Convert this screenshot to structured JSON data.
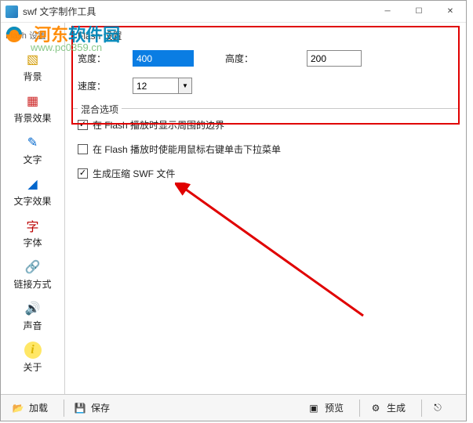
{
  "window": {
    "title": "swf 文字制作工具"
  },
  "watermark": {
    "text_a": "河东",
    "text_b": "软件园",
    "url": "www.pc0359.cn"
  },
  "sidebar": {
    "header": "Flash 设置",
    "items": [
      {
        "label": "背景"
      },
      {
        "label": "背景效果"
      },
      {
        "label": "文字"
      },
      {
        "label": "文字效果"
      },
      {
        "label": "字体"
      },
      {
        "label": "链接方式"
      },
      {
        "label": "声音"
      },
      {
        "label": "关于"
      }
    ]
  },
  "flash_settings": {
    "group_title": "Flash 设置",
    "width_label": "宽度：",
    "width_value": "400",
    "height_label": "高度：",
    "height_value": "200",
    "speed_label": "速度：",
    "speed_value": "12"
  },
  "blend_options": {
    "group_title": "混合选项",
    "opt1": {
      "label": "在 Flash 播放时显示周围的边界",
      "checked": true
    },
    "opt2": {
      "label": "在 Flash 播放时使能用鼠标右键单击下拉菜单",
      "checked": false
    },
    "opt3": {
      "label": "生成压缩 SWF 文件",
      "checked": true
    }
  },
  "bottombar": {
    "load": "加载",
    "save": "保存",
    "preview": "预览",
    "generate": "生成"
  }
}
